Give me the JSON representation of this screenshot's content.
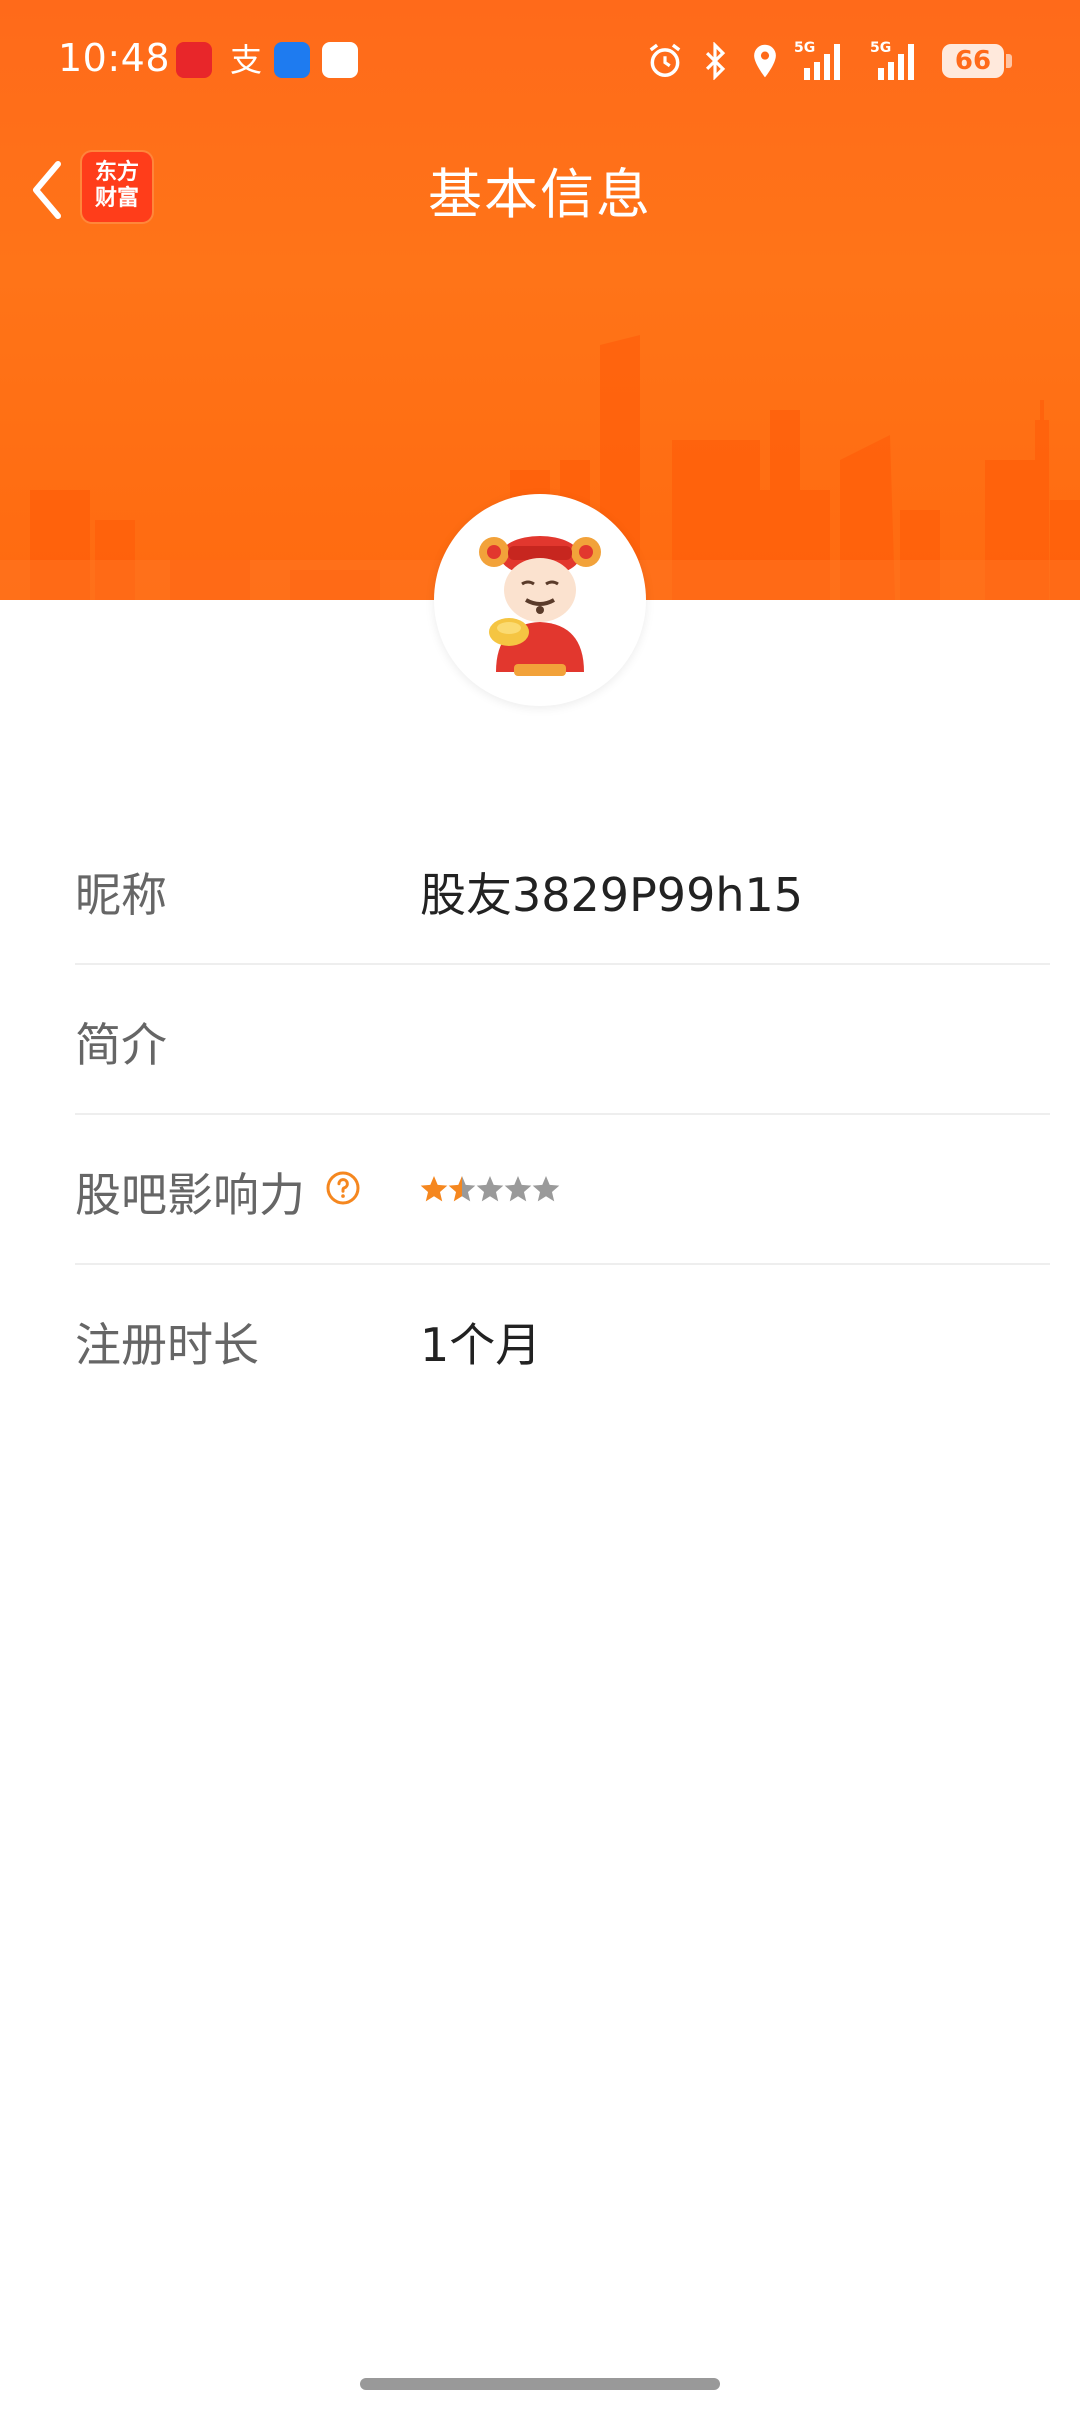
{
  "status_bar": {
    "time": "10:48",
    "network_1": "5G",
    "network_2": "5G",
    "battery": "66"
  },
  "nav": {
    "title": "基本信息",
    "brand_logo_line1": "东方",
    "brand_logo_line2": "财富"
  },
  "profile": {
    "rows": [
      {
        "label": "昵称",
        "value": "股友3829P99h15"
      },
      {
        "label": "简介",
        "value": ""
      },
      {
        "label": "股吧影响力",
        "rating": 1.5,
        "max_rating": 5
      },
      {
        "label": "注册时长",
        "value": "1个月"
      }
    ]
  },
  "colors": {
    "brand_orange": "#ff6a1a",
    "star_active": "#f5871f",
    "star_inactive": "#9a9a9a",
    "help_icon": "#f5871f"
  },
  "icons": {
    "back": "chevron-left-icon",
    "help": "question-circle-icon",
    "alarm": "alarm-icon",
    "bluetooth": "bluetooth-icon",
    "location": "location-pin-icon"
  }
}
